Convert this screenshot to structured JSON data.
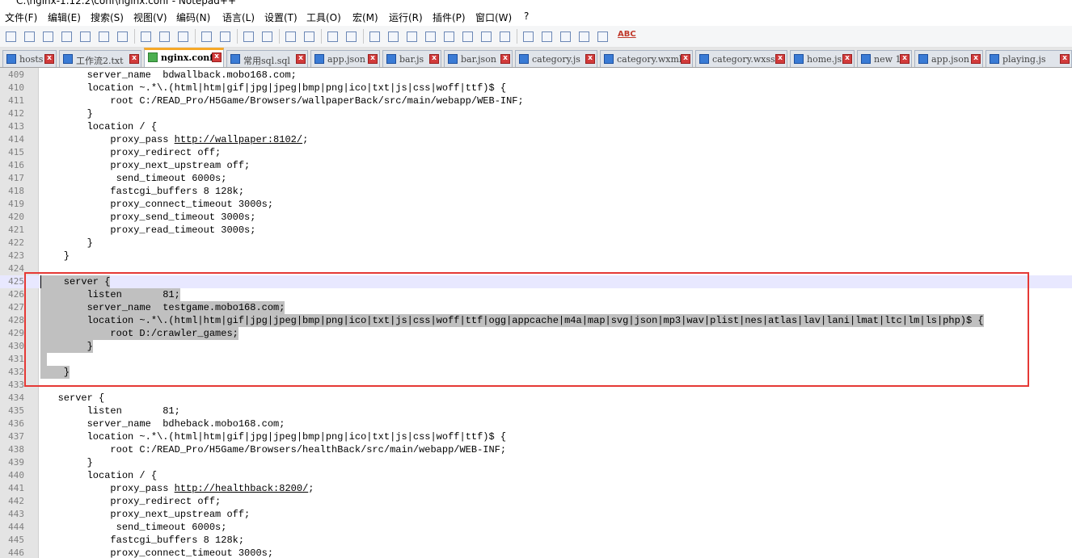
{
  "window": {
    "title": "C:\\nginx-1.12.2\\conf\\nginx.conf - Notepad++"
  },
  "menu": [
    {
      "label": "文件(F)",
      "name": "menu-file"
    },
    {
      "label": "编辑(E)",
      "name": "menu-edit"
    },
    {
      "label": "搜索(S)",
      "name": "menu-search"
    },
    {
      "label": "视图(V)",
      "name": "menu-view"
    },
    {
      "label": "编码(N)",
      "name": "menu-encoding"
    },
    {
      "label": "语言(L)",
      "name": "menu-language"
    },
    {
      "label": "设置(T)",
      "name": "menu-settings"
    },
    {
      "label": "工具(O)",
      "name": "menu-tools"
    },
    {
      "label": "宏(M)",
      "name": "menu-macro"
    },
    {
      "label": "运行(R)",
      "name": "menu-run"
    },
    {
      "label": "插件(P)",
      "name": "menu-plugins"
    },
    {
      "label": "窗口(W)",
      "name": "menu-window"
    },
    {
      "label": "?",
      "name": "menu-help"
    }
  ],
  "toolbar": {
    "buttons": [
      "new-file-icon",
      "open-file-icon",
      "save-icon",
      "save-all-icon",
      "close-icon",
      "close-all-icon",
      "print-icon",
      "cut-icon",
      "copy-icon",
      "paste-icon",
      "undo-icon",
      "redo-icon",
      "find-icon",
      "replace-icon",
      "zoom-in-icon",
      "zoom-out-icon",
      "sync-vertical-icon",
      "sync-horizontal-icon",
      "word-wrap-icon",
      "show-all-chars-icon",
      "indent-guide-icon",
      "function-list-icon",
      "document-map-icon",
      "clipboard-history-icon",
      "folder-workspace-icon",
      "monitor-icon",
      "record-macro-icon",
      "stop-macro-icon",
      "play-macro-icon",
      "run-macro-multiple-icon",
      "save-macro-icon"
    ],
    "spellcheck_label": "ABC"
  },
  "tabs": [
    {
      "label": "hosts",
      "active": false
    },
    {
      "label": "工作流2.txt",
      "active": false
    },
    {
      "label": "nginx.conf",
      "active": true
    },
    {
      "label": "常用sql.sql",
      "active": false
    },
    {
      "label": "app.json",
      "active": false
    },
    {
      "label": "bar.js",
      "active": false
    },
    {
      "label": "bar.json",
      "active": false
    },
    {
      "label": "category.js",
      "active": false
    },
    {
      "label": "category.wxml",
      "active": false
    },
    {
      "label": "category.wxss",
      "active": false
    },
    {
      "label": "home.js",
      "active": false
    },
    {
      "label": "new 1",
      "active": false
    },
    {
      "label": "app.json",
      "active": false
    },
    {
      "label": "playing.js",
      "active": false
    }
  ],
  "tab_close_glyph": "x",
  "editor": {
    "lines": [
      {
        "num": "409",
        "text": "        server_name  bdwallback.mobo168.com;"
      },
      {
        "num": "410",
        "text": "        location ~.*\\.(html|htm|gif|jpg|jpeg|bmp|png|ico|txt|js|css|woff|ttf)$ {"
      },
      {
        "num": "411",
        "text": "            root C:/READ_Pro/H5Game/Browsers/wallpaperBack/src/main/webapp/WEB-INF;"
      },
      {
        "num": "412",
        "text": "        }"
      },
      {
        "num": "413",
        "text": "        location / {"
      },
      {
        "num": "414",
        "text": "            proxy_pass ",
        "url": "http://wallpaper:8102/",
        "after": ";"
      },
      {
        "num": "415",
        "text": "            proxy_redirect off;"
      },
      {
        "num": "416",
        "text": "            proxy_next_upstream off;"
      },
      {
        "num": "417",
        "text": "             send_timeout 6000s;"
      },
      {
        "num": "418",
        "text": "            fastcgi_buffers 8 128k;"
      },
      {
        "num": "419",
        "text": "            proxy_connect_timeout 3000s;"
      },
      {
        "num": "420",
        "text": "            proxy_send_timeout 3000s;"
      },
      {
        "num": "421",
        "text": "            proxy_read_timeout 3000s;"
      },
      {
        "num": "422",
        "text": "        }"
      },
      {
        "num": "423",
        "text": "    }"
      },
      {
        "num": "424",
        "text": ""
      },
      {
        "num": "425",
        "text": "    server {",
        "sel": true,
        "current": true
      },
      {
        "num": "426",
        "text": "        listen       81;",
        "sel": true
      },
      {
        "num": "427",
        "text": "        server_name  testgame.mobo168.com;",
        "sel": true
      },
      {
        "num": "428",
        "text": "        location ~.*\\.(html|htm|gif|jpg|jpeg|bmp|png|ico|txt|js|css|woff|ttf|ogg|appcache|m4a|map|svg|json|mp3|wav|plist|nes|atlas|lav|lani|lmat|ltc|lm|ls|php)$ {",
        "sel": true
      },
      {
        "num": "429",
        "text": "            root D:/crawler_games;",
        "sel": true
      },
      {
        "num": "430",
        "text": "        }",
        "sel": true
      },
      {
        "num": "431",
        "text": "",
        "sel": true
      },
      {
        "num": "432",
        "text": "    }",
        "sel": true
      },
      {
        "num": "433",
        "text": ""
      },
      {
        "num": "434",
        "text": "   server {"
      },
      {
        "num": "435",
        "text": "        listen       81;"
      },
      {
        "num": "436",
        "text": "        server_name  bdheback.mobo168.com;"
      },
      {
        "num": "437",
        "text": "        location ~.*\\.(html|htm|gif|jpg|jpeg|bmp|png|ico|txt|js|css|woff|ttf)$ {"
      },
      {
        "num": "438",
        "text": "            root C:/READ_Pro/H5Game/Browsers/healthBack/src/main/webapp/WEB-INF;"
      },
      {
        "num": "439",
        "text": "        }"
      },
      {
        "num": "440",
        "text": "        location / {"
      },
      {
        "num": "441",
        "text": "            proxy_pass ",
        "url": "http://healthback:8200/",
        "after": ";"
      },
      {
        "num": "442",
        "text": "            proxy_redirect off;"
      },
      {
        "num": "443",
        "text": "            proxy_next_upstream off;"
      },
      {
        "num": "444",
        "text": "             send_timeout 6000s;"
      },
      {
        "num": "445",
        "text": "            fastcgi_buffers 8 128k;"
      },
      {
        "num": "446",
        "text": "            proxy_connect_timeout 3000s;"
      }
    ]
  }
}
